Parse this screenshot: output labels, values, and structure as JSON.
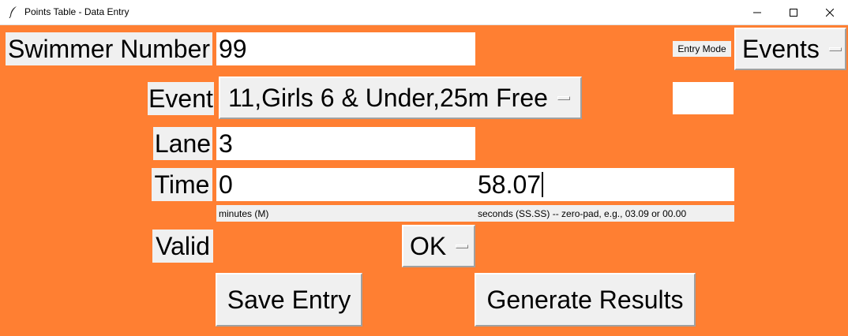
{
  "window": {
    "title": "Points Table - Data Entry",
    "icon": "feather-icon",
    "controls": [
      "minimize-icon",
      "maximize-icon",
      "close-icon"
    ]
  },
  "swimmer": {
    "label": "Swimmer Number",
    "value": "99"
  },
  "entry_mode": {
    "label": "Entry Mode",
    "selected": "Events"
  },
  "event": {
    "label": "Event",
    "selected": "11,Girls 6 & Under,25m Free",
    "side_value": ""
  },
  "lane": {
    "label": "Lane",
    "value": "3"
  },
  "time": {
    "label": "Time",
    "minutes_value": "0",
    "seconds_value": "58.07",
    "minutes_hint": "minutes (M)",
    "seconds_hint": "seconds (SS.SS) -- zero-pad, e.g., 03.09 or 00.00"
  },
  "valid": {
    "label": "Valid",
    "selected": "OK"
  },
  "actions": {
    "save": "Save Entry",
    "generate": "Generate Results"
  }
}
